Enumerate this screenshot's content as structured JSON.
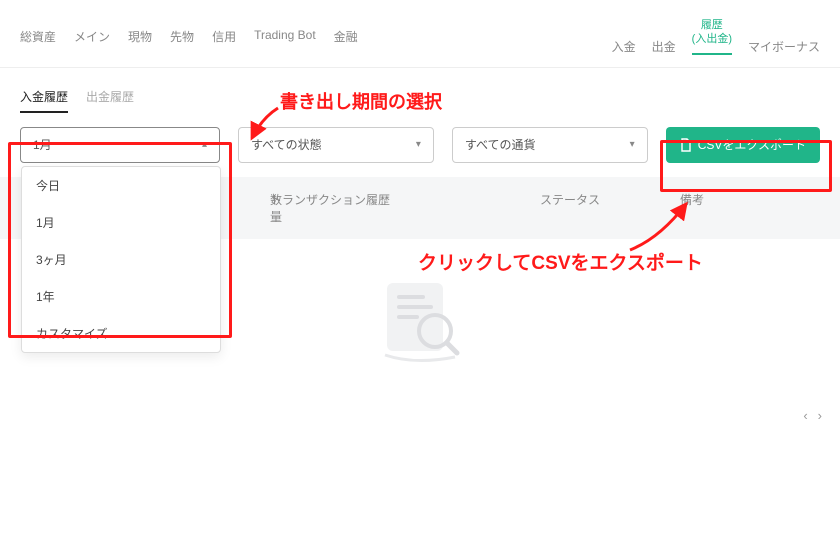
{
  "topnav": {
    "left": [
      "総資産",
      "メイン",
      "現物",
      "先物",
      "信用",
      "Trading Bot",
      "金融"
    ],
    "right": [
      "入金",
      "出金"
    ],
    "active": {
      "line1": "履歴",
      "line2": "(入出金)"
    },
    "bonus": "マイボーナス"
  },
  "tabs": {
    "deposit": "入金履歴",
    "withdraw": "出金履歴"
  },
  "filters": {
    "period_selected": "1月",
    "status_selected": "すべての状態",
    "currency_selected": "すべての通貨",
    "export_label": "CSVをエクスポート",
    "options": [
      "今日",
      "1月",
      "3ヶ月",
      "1年",
      "カスタマイズ"
    ]
  },
  "table": {
    "amount": "数量",
    "tx": "トランザクション履歴",
    "status": "ステータス",
    "note": "備考"
  },
  "annotations": {
    "period_label": "書き出し期間の選択",
    "export_label": "クリックしてCSVをエクスポート"
  }
}
